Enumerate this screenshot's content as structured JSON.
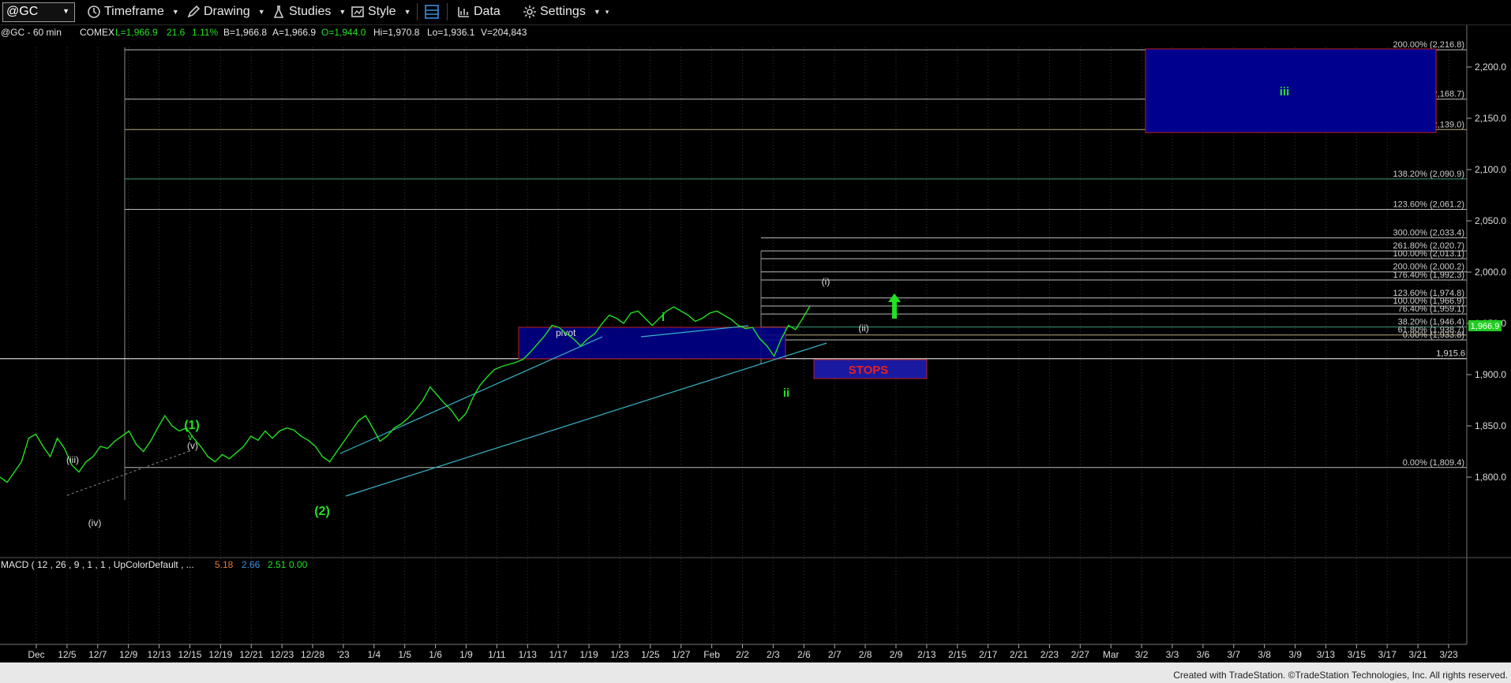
{
  "toolbar": {
    "symbol": "@GC",
    "timeframe": "Timeframe",
    "drawing": "Drawing",
    "studies": "Studies",
    "style": "Style",
    "data": "Data",
    "settings": "Settings"
  },
  "header": {
    "title": "@GC - 60 min",
    "exchange": "COMEX",
    "last": "L=1,966.9",
    "change": "21.6",
    "pct": "1.11%",
    "bid": "B=1,966.8",
    "ask": "A=1,966.9",
    "open": "O=1,944.0",
    "high": "Hi=1,970.8",
    "low": "Lo=1,936.1",
    "volume": "V=204,843"
  },
  "price_axis": {
    "ticks": [
      "2,200.0",
      "2,150.0",
      "2,100.0",
      "2,050.0",
      "2,000.0",
      "1,950.0",
      "1,900.0",
      "1,850.0",
      "1,800.0"
    ],
    "last_price": "1,966.9"
  },
  "date_axis": {
    "labels": [
      "Dec",
      "12/5",
      "12/7",
      "12/9",
      "12/13",
      "12/15",
      "12/19",
      "12/21",
      "12/23",
      "12/28",
      "'23",
      "1/4",
      "1/5",
      "1/6",
      "1/9",
      "1/11",
      "1/13",
      "1/17",
      "1/19",
      "1/23",
      "1/25",
      "1/27",
      "Feb",
      "2/2",
      "2/3",
      "2/6",
      "2/7",
      "2/8",
      "2/9",
      "2/13",
      "2/15",
      "2/17",
      "2/21",
      "2/23",
      "2/27",
      "Mar",
      "3/2",
      "3/3",
      "3/6",
      "3/7",
      "3/8",
      "3/9",
      "3/13",
      "3/15",
      "3/17",
      "3/21",
      "3/23"
    ]
  },
  "fib_levels_upper": [
    {
      "label": "200.00% (2,216.8)",
      "price": 2216.8,
      "color": "#bbbbbb"
    },
    {
      "label": "176.40% (2,168.7)",
      "price": 2168.7,
      "color": "#bbbbbb"
    },
    {
      "label": "161.80% (2,139.0)",
      "price": 2139.0,
      "color": "#b5aa7a"
    },
    {
      "label": "138.20% (2,090.9)",
      "price": 2090.9,
      "color": "#3e9a82"
    },
    {
      "label": "123.60% (2,061.2)",
      "price": 2061.2,
      "color": "#bbbbbb"
    },
    {
      "label": "0.00% (1,809.4)",
      "price": 1809.4,
      "color": "#bbbbbb"
    }
  ],
  "fib_levels_lower": [
    {
      "label": "300.00% (2,033.4)",
      "price": 2033.4,
      "color": "#bbbbbb"
    },
    {
      "label": "261.80% (2,020.7)",
      "price": 2020.7,
      "color": "#bbbbbb"
    },
    {
      "label": "100.00% (2,013.1)",
      "price": 2013.1,
      "color": "#bbbbbb"
    },
    {
      "label": "200.00% (2,000.2)",
      "price": 2000.2,
      "color": "#bbbbbb"
    },
    {
      "label": "176.40% (1,992.3)",
      "price": 1992.3,
      "color": "#bbbbbb"
    },
    {
      "label": "123.60% (1,974.8)",
      "price": 1974.8,
      "color": "#bbbbbb"
    },
    {
      "label": "100.00% (1,966.9)",
      "price": 1966.9,
      "color": "#bbbbbb"
    },
    {
      "label": "76.40% (1,959.1)",
      "price": 1959.1,
      "color": "#bbbbbb"
    },
    {
      "label": "38.20% (1,946.4)",
      "price": 1946.4,
      "color": "#3e9a82"
    },
    {
      "label": "61.80% (1,938.7)",
      "price": 1938.7,
      "color": "#b5aa7a"
    },
    {
      "label": "0.00% (1,933.8)",
      "price": 1933.8,
      "color": "#bbbbbb"
    }
  ],
  "support_level": {
    "label": "1,915.6",
    "price": 1915.6
  },
  "annotations": {
    "wave_iii_box": "iii",
    "stops": "STOPS",
    "pivot": "pivot",
    "wave_i_green": "i",
    "wave_ii_green": "ii",
    "wave_i_white": "(i)",
    "wave_ii_white": "(ii)",
    "wave_1": "(1)",
    "wave_2": "(2)",
    "wave_v": "v",
    "wave_v_paren": "(v)",
    "wave_iii_white": "(iii)",
    "wave_iv_white": "(iv)"
  },
  "macd": {
    "label": "MACD ( 12 , 26 , 9 , 1 , 1 , UpColorDefault , ...",
    "v1": "5.18",
    "v2": "2.66",
    "v3": "2.51",
    "v4": "0.00"
  },
  "footer": "Created with TradeStation. ©TradeStation Technologies, Inc. All rights reserved.",
  "colors": {
    "price_line": "#22e022",
    "wave_box": "#00008f",
    "stops_box": "#1a1aa0",
    "stops_text": "#e82020",
    "arrow": "#22e022",
    "channel": "#37b6c9"
  },
  "chart_data": {
    "type": "line",
    "price_axis_range": [
      1760,
      2235
    ],
    "series": [
      {
        "values": [
          1800,
          1795,
          1805,
          1815,
          1838,
          1842,
          1830,
          1820,
          1838,
          1828,
          1812,
          1805,
          1815,
          1820,
          1830,
          1828,
          1835,
          1840,
          1845,
          1832,
          1825,
          1835,
          1848,
          1860,
          1850,
          1845,
          1848,
          1838,
          1830,
          1820,
          1815,
          1822,
          1818,
          1824,
          1830,
          1840,
          1836,
          1845,
          1838,
          1845,
          1848,
          1846,
          1840,
          1836,
          1830,
          1820,
          1815,
          1825,
          1835,
          1845,
          1855,
          1860,
          1848,
          1835,
          1840,
          1848,
          1852,
          1858,
          1866,
          1875,
          1888,
          1880,
          1872,
          1865,
          1855,
          1862,
          1878,
          1890,
          1898,
          1905,
          1908,
          1910,
          1912,
          1915,
          1922,
          1930,
          1938,
          1948,
          1946,
          1940,
          1935,
          1928,
          1935,
          1940,
          1950,
          1958,
          1955,
          1950,
          1960,
          1962,
          1955,
          1948,
          1955,
          1962,
          1966,
          1962,
          1958,
          1952,
          1955,
          1960,
          1962,
          1958,
          1954,
          1948,
          1945,
          1946,
          1935,
          1928,
          1918,
          1935,
          1948,
          1944,
          1955,
          1966.9
        ]
      }
    ]
  }
}
